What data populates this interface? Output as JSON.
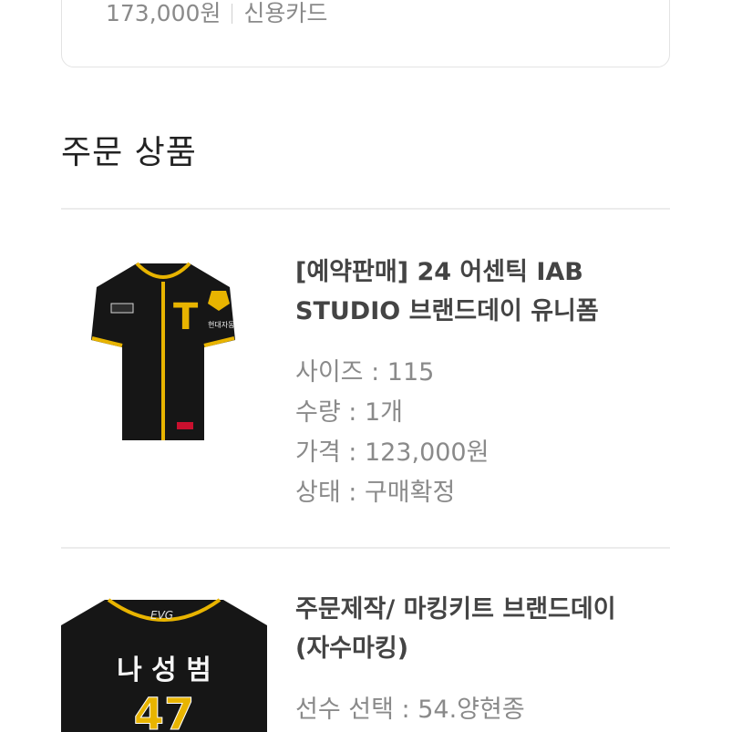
{
  "payment_summary": {
    "amount": "173,000원",
    "method": "신용카드"
  },
  "section": {
    "title": "주문 상품"
  },
  "items": [
    {
      "title_line1": "[예약판매] 24 어센틱 IAB",
      "title_line2": "STUDIO 브랜드데이 유니폼",
      "attrs": [
        {
          "label": "사이즈",
          "value": "115"
        },
        {
          "label": "수량",
          "value": "1개"
        },
        {
          "label": "가격",
          "value": "123,000원"
        },
        {
          "label": "상태",
          "value": "구매확정"
        }
      ],
      "image": {
        "chest_logo": "T",
        "sleeve_text": "현대자동"
      }
    },
    {
      "title_line1": "주문제작/ 마킹키트 브랜드데이",
      "title_line2": "(자수마킹)",
      "attrs": [
        {
          "label": "선수 선택",
          "value": "54.양현종"
        }
      ],
      "image": {
        "brand": "EVG",
        "player_name": "나 성 범",
        "number": "47"
      }
    }
  ],
  "colors": {
    "jersey": "#161616",
    "piping": "#e8b400",
    "accent_red": "#c8102e"
  }
}
